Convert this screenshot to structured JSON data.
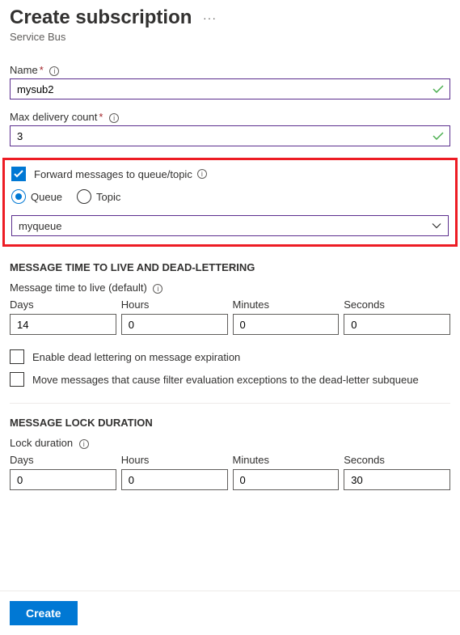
{
  "header": {
    "title": "Create subscription",
    "subtitle": "Service Bus"
  },
  "name_field": {
    "label": "Name",
    "value": "mysub2"
  },
  "max_delivery": {
    "label": "Max delivery count",
    "value": "3"
  },
  "forward": {
    "checkbox_label": "Forward messages to queue/topic",
    "option_queue": "Queue",
    "option_topic": "Topic",
    "selected_value": "myqueue"
  },
  "ttl_section": {
    "heading": "MESSAGE TIME TO LIVE AND DEAD-LETTERING",
    "sublabel": "Message time to live (default)",
    "cols": {
      "days": "Days",
      "hours": "Hours",
      "minutes": "Minutes",
      "seconds": "Seconds"
    },
    "values": {
      "days": "14",
      "hours": "0",
      "minutes": "0",
      "seconds": "0"
    },
    "cb_dead_letter": "Enable dead lettering on message expiration",
    "cb_filter_exc": "Move messages that cause filter evaluation exceptions to the dead-letter subqueue"
  },
  "lock_section": {
    "heading": "MESSAGE LOCK DURATION",
    "sublabel": "Lock duration",
    "cols": {
      "days": "Days",
      "hours": "Hours",
      "minutes": "Minutes",
      "seconds": "Seconds"
    },
    "values": {
      "days": "0",
      "hours": "0",
      "minutes": "0",
      "seconds": "30"
    }
  },
  "footer": {
    "create_label": "Create"
  }
}
